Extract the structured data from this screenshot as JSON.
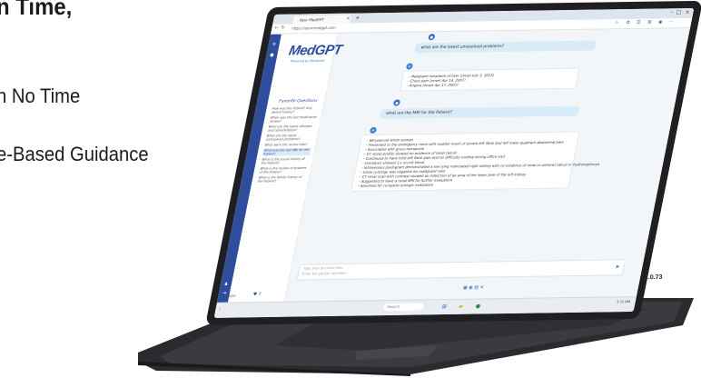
{
  "marketing": {
    "top_line": "n Time, ",
    "line1": "n No Time",
    "line2": "e-Based Guidance"
  },
  "browser": {
    "tab_title": "Ayur MedGPT",
    "url": "https://ayurmedgpt.com",
    "new_tab_symbol": "+",
    "tab_close_symbol": "×"
  },
  "sidebar": {
    "logo": "MedGPT",
    "tagline": "Powered by Medeinfo",
    "faq_title": "Favorite Questions",
    "faq_items": [
      "How was the Patient? Any dental history?",
      "When was the last medication review?",
      "What are the latest allergies and comorbidities?",
      "What are the latest unresolved problems?",
      "What were the recent labs?",
      "What was the last MRI for the Patient?",
      "What is the social history of the Patient?",
      "What is the review of systems of the Patient?",
      "What is the family history of the Patient?"
    ],
    "active_index": 5,
    "footer": "♥ ?"
  },
  "chat": {
    "q1": "what are the latest unresolved problems?",
    "a1": [
      "- Malignant neoplasm of liver (onset July 3, 2013)",
      "- Chest pain (onset Apr 14, 2007)",
      "- Angina (onset Apr 17, 2007)"
    ],
    "q2": "what are the MRI for the Patient?",
    "a2": [
      "- 66-year-old white woman",
      "- Presented to the emergency room with sudden onset of severe left flank and left lower quadrant abdominal pain",
      "- Associated with gross hematuria",
      "- CT stone profile showed no evidence of renal calculi",
      "- Continued to have mild left flank pain and no difficulty voiding during office visit",
      "- Urinalysis showed 1+ occult blood",
      "- Intravenous pyelogram demonstrated a low lying malrotated right kidney with no evidence of renal or ureteral calculi or hydronephrosis",
      "- Urine cytology was negative for malignant cells",
      "- CT renal scan with contrast showed an infarction of an area of the lower pole of the left kidney",
      "- Suggested to have a renal MRI for further evaluation",
      "- Admitted for complete urologic evaluation"
    ],
    "input_placeholder": "Type your question here",
    "input_placeholder2": "Enter the patient identifier",
    "send_icon": "send-icon"
  },
  "taskbar": {
    "search": "Search",
    "clock": "1:31 AM",
    "left_label": "Changes",
    "left_label2": "Opened Search Date"
  },
  "version_label": "1.0.73"
}
